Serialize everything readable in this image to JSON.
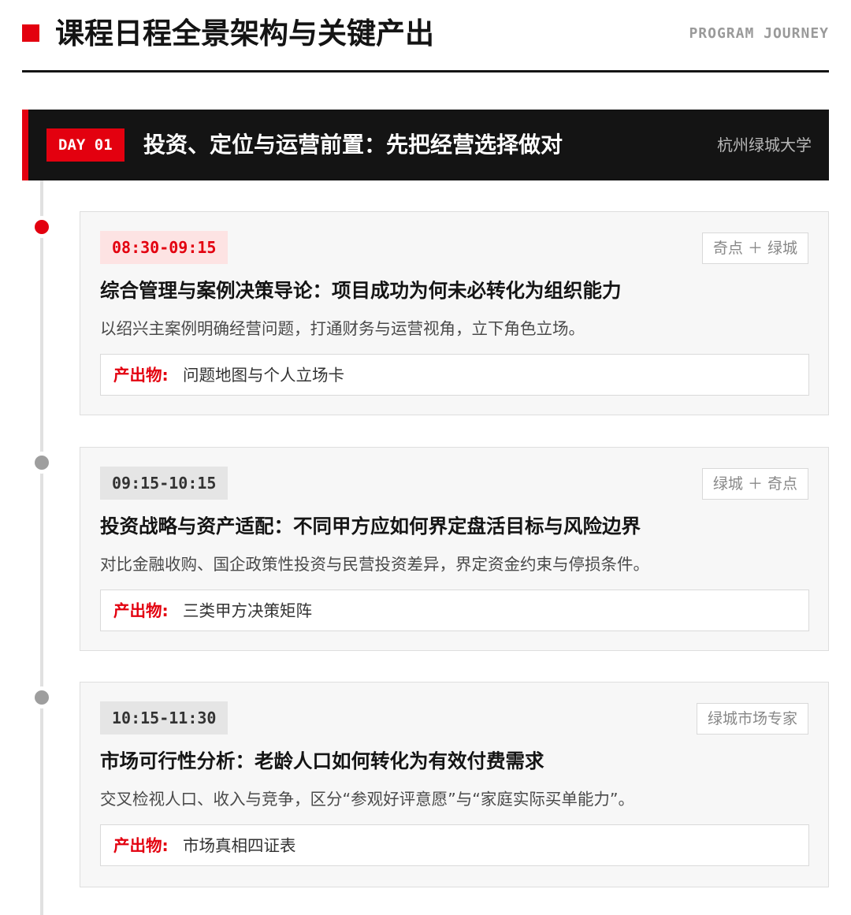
{
  "header": {
    "title": "课程日程全景架构与关键产出",
    "subtitle": "PROGRAM JOURNEY"
  },
  "day": {
    "badge": "DAY 01",
    "title": "投资、定位与运营前置：先把经营选择做对",
    "location": "杭州绿城大学"
  },
  "output_label": "产出物:",
  "sessions": [
    {
      "time": "08:30-09:15",
      "speaker": "奇点 ＋ 绿城",
      "title": "综合管理与案例决策导论：项目成功为何未必转化为组织能力",
      "desc": "以绍兴主案例明确经营问题，打通财务与运营视角，立下角色立场。",
      "output": "问题地图与个人立场卡"
    },
    {
      "time": "09:15-10:15",
      "speaker": "绿城 ＋ 奇点",
      "title": "投资战略与资产适配：不同甲方应如何界定盘活目标与风险边界",
      "desc": "对比金融收购、国企政策性投资与民营投资差异，界定资金约束与停损条件。",
      "output": "三类甲方决策矩阵"
    },
    {
      "time": "10:15-11:30",
      "speaker": "绿城市场专家",
      "title": "市场可行性分析：老龄人口如何转化为有效付费需求",
      "desc": "交叉检视人口、收入与竞争，区分“参观好评意愿”与“家庭实际买单能力”。",
      "output": "市场真相四证表"
    }
  ],
  "colors": {
    "accent": "#e3000f",
    "dark": "#141414",
    "card_bg": "#f7f7f7"
  }
}
